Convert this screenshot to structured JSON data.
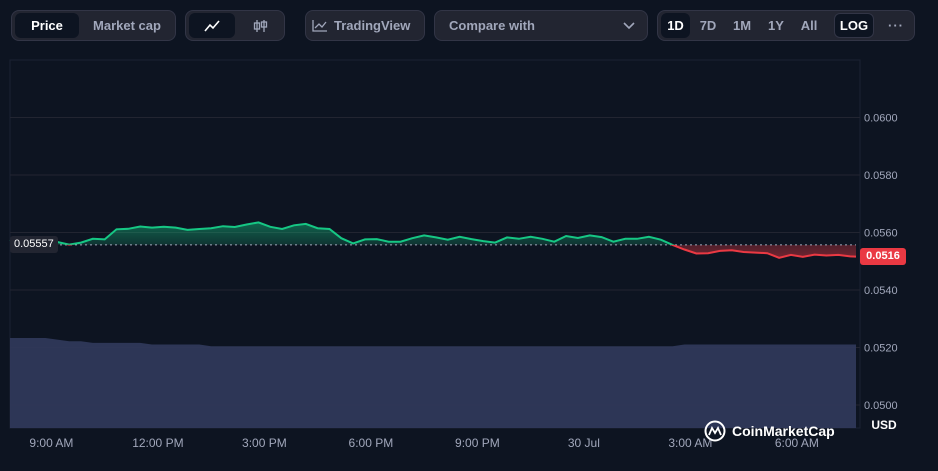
{
  "toolbar": {
    "view_tabs": [
      "Price",
      "Market cap"
    ],
    "active_view": "Price",
    "chart_type_icons": [
      "line-chart-icon",
      "candlestick-icon"
    ],
    "tradingview_label": "TradingView",
    "compare_placeholder": "Compare with",
    "ranges": [
      "1D",
      "7D",
      "1M",
      "1Y",
      "All"
    ],
    "active_range": "1D",
    "log_label": "LOG",
    "more_label": "···"
  },
  "watermark": "CoinMarketCap",
  "colors": {
    "up": "#16c784",
    "down": "#ea3943",
    "volume": "#313a5c",
    "grid": "#222531",
    "background": "#0d1421"
  },
  "chart_data": {
    "type": "line",
    "x": [
      "07:50",
      "08:10",
      "08:30",
      "08:50",
      "09:10",
      "09:30",
      "09:50",
      "10:10",
      "10:30",
      "10:50",
      "11:10",
      "11:30",
      "11:50",
      "12:10",
      "12:30",
      "12:50",
      "13:10",
      "13:30",
      "13:50",
      "14:10",
      "14:30",
      "14:50",
      "15:10",
      "15:30",
      "15:50",
      "16:10",
      "16:30",
      "16:50",
      "17:10",
      "17:30",
      "17:50",
      "18:10",
      "18:30",
      "18:50",
      "19:10",
      "19:30",
      "19:50",
      "20:10",
      "20:30",
      "20:50",
      "21:10",
      "21:30",
      "21:50",
      "22:10",
      "22:30",
      "22:50",
      "23:10",
      "23:30",
      "23:50",
      "00:10",
      "00:30",
      "00:50",
      "01:10",
      "01:30",
      "01:50",
      "02:10",
      "02:30",
      "02:50",
      "03:10",
      "03:30",
      "03:50",
      "04:10",
      "04:30",
      "04:50",
      "05:10",
      "05:30",
      "05:50",
      "06:10",
      "06:30",
      "06:50",
      "07:10",
      "07:30",
      "07:40"
    ],
    "series": [
      {
        "values": [
          0.05575,
          0.05564,
          0.05581,
          0.05584,
          0.05567,
          0.05558,
          0.05565,
          0.05578,
          0.05576,
          0.05611,
          0.05613,
          0.05621,
          0.05617,
          0.0562,
          0.05617,
          0.05609,
          0.05612,
          0.05615,
          0.05622,
          0.05619,
          0.05628,
          0.05635,
          0.0562,
          0.05612,
          0.05625,
          0.0563,
          0.05615,
          0.05612,
          0.0558,
          0.05562,
          0.05576,
          0.05577,
          0.05568,
          0.05568,
          0.0558,
          0.0559,
          0.05583,
          0.05575,
          0.05585,
          0.05577,
          0.0557,
          0.05565,
          0.05583,
          0.05578,
          0.05585,
          0.05578,
          0.05568,
          0.05588,
          0.05581,
          0.0559,
          0.05584,
          0.05568,
          0.05578,
          0.05578,
          0.05585,
          0.05575,
          0.05557,
          0.05541,
          0.05527,
          0.05528,
          0.05536,
          0.05538,
          0.05532,
          0.0553,
          0.05528,
          0.05512,
          0.05522,
          0.05515,
          0.05523,
          0.0552,
          0.05522,
          0.05517,
          0.05516
        ]
      }
    ],
    "volume": [
      0.55,
      0.55,
      0.55,
      0.55,
      0.54,
      0.53,
      0.53,
      0.52,
      0.52,
      0.52,
      0.52,
      0.52,
      0.51,
      0.51,
      0.51,
      0.51,
      0.51,
      0.5,
      0.5,
      0.5,
      0.5,
      0.5,
      0.5,
      0.5,
      0.5,
      0.5,
      0.5,
      0.5,
      0.5,
      0.5,
      0.5,
      0.5,
      0.5,
      0.5,
      0.5,
      0.5,
      0.5,
      0.5,
      0.5,
      0.5,
      0.5,
      0.5,
      0.5,
      0.5,
      0.5,
      0.5,
      0.5,
      0.5,
      0.5,
      0.5,
      0.5,
      0.5,
      0.5,
      0.5,
      0.5,
      0.5,
      0.5,
      0.51,
      0.51,
      0.51,
      0.51,
      0.51,
      0.51,
      0.51,
      0.51,
      0.51,
      0.51,
      0.51,
      0.51,
      0.51,
      0.51,
      0.51,
      0.51
    ],
    "reference_value": 0.05557,
    "reference_label": "0.05557",
    "current_label": "0.0516",
    "ylabel": "USD",
    "ylim": [
      0.0492,
      0.062
    ],
    "yticks": [
      0.05,
      0.052,
      0.054,
      0.056,
      0.058,
      0.06
    ],
    "ytick_labels": [
      "0.0500",
      "0.0520",
      "0.0540",
      "0.0560",
      "0.0580",
      "0.0600"
    ],
    "xtick_labels": [
      "9:00 AM",
      "12:00 PM",
      "3:00 PM",
      "6:00 PM",
      "9:00 PM",
      "30 Jul",
      "3:00 AM",
      "6:00 AM"
    ],
    "xtick_times": [
      "09:00",
      "12:00",
      "15:00",
      "18:00",
      "21:00",
      "00:00",
      "03:00",
      "06:00"
    ],
    "x_start": "07:50",
    "x_end": "07:40",
    "grid": true
  }
}
